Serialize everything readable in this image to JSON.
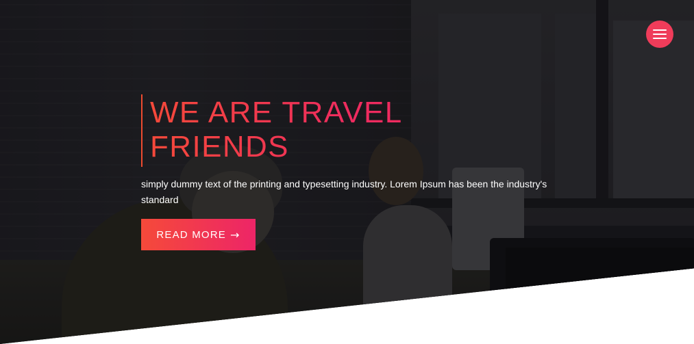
{
  "header": {
    "menu_icon": "hamburger-menu-icon"
  },
  "hero": {
    "title_line1": "WE ARE TRAVEL",
    "title_line2": "FRIENDS",
    "description": "simply dummy text of the printing and typesetting industry. Lorem Ipsum has been the industry's standard",
    "cta_label": "READ MORE",
    "cta_icon": "→"
  },
  "colors": {
    "accent_start": "#f54a3a",
    "accent_end": "#ed2567",
    "menu_button": "#ef3c5a",
    "text": "#ffffff"
  }
}
